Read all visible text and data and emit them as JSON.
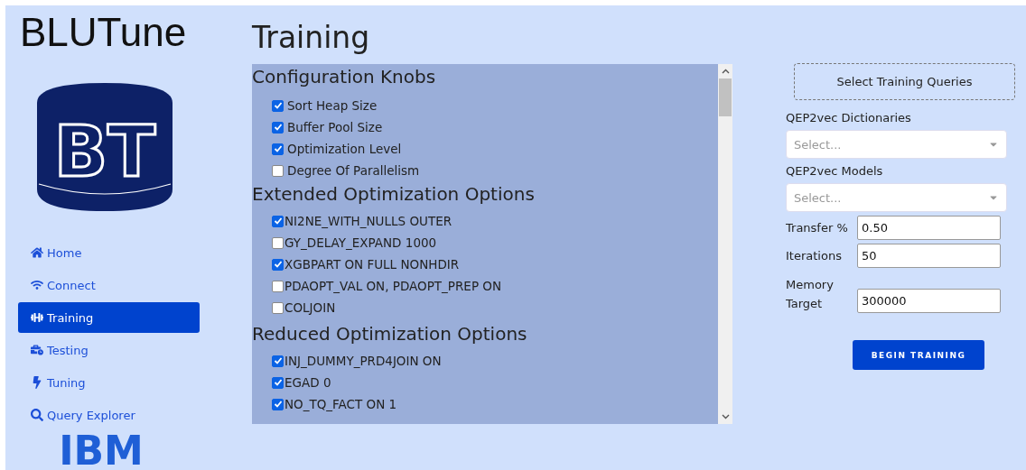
{
  "app_title": "BLUTune",
  "logo": {
    "text": "BT"
  },
  "nav": [
    {
      "label": "Home",
      "selected": false
    },
    {
      "label": "Connect",
      "selected": false
    },
    {
      "label": "Training",
      "selected": true
    },
    {
      "label": "Testing",
      "selected": false
    },
    {
      "label": "Tuning",
      "selected": false
    },
    {
      "label": "Query Explorer",
      "selected": false
    }
  ],
  "footer_logo": {
    "text": "IBM"
  },
  "page_title": "Training",
  "sections": [
    {
      "title": "Configuration Knobs",
      "options": [
        {
          "label": "Sort Heap Size",
          "checked": true
        },
        {
          "label": "Buffer Pool Size",
          "checked": true
        },
        {
          "label": "Optimization Level",
          "checked": true
        },
        {
          "label": "Degree Of Parallelism",
          "checked": false
        }
      ]
    },
    {
      "title": "Extended Optimization Options",
      "options": [
        {
          "label": "NI2NE_WITH_NULLS OUTER",
          "checked": true
        },
        {
          "label": "GY_DELAY_EXPAND 1000",
          "checked": false
        },
        {
          "label": "XGBPART ON FULL NONHDIR",
          "checked": true
        },
        {
          "label": "PDAOPT_VAL ON, PDAOPT_PREP ON",
          "checked": false
        },
        {
          "label": "COLJOIN",
          "checked": false
        }
      ]
    },
    {
      "title": "Reduced Optimization Options",
      "options": [
        {
          "label": "INJ_DUMMY_PRD4JOIN ON",
          "checked": true
        },
        {
          "label": "EGAD 0",
          "checked": true
        },
        {
          "label": "NO_TQ_FACT ON 1",
          "checked": true
        }
      ]
    }
  ],
  "select_queries_button": "Select Training Queries",
  "dropdowns": [
    {
      "label": "QEP2vec Dictionaries",
      "placeholder": "Select..."
    },
    {
      "label": "QEP2vec Models",
      "placeholder": "Select..."
    }
  ],
  "fields": [
    {
      "label": "Transfer %",
      "value": "0.50"
    },
    {
      "label": "Iterations",
      "value": "50"
    },
    {
      "label": "Memory Target",
      "value": "300000"
    }
  ],
  "begin_button": "BEGIN TRAINING"
}
